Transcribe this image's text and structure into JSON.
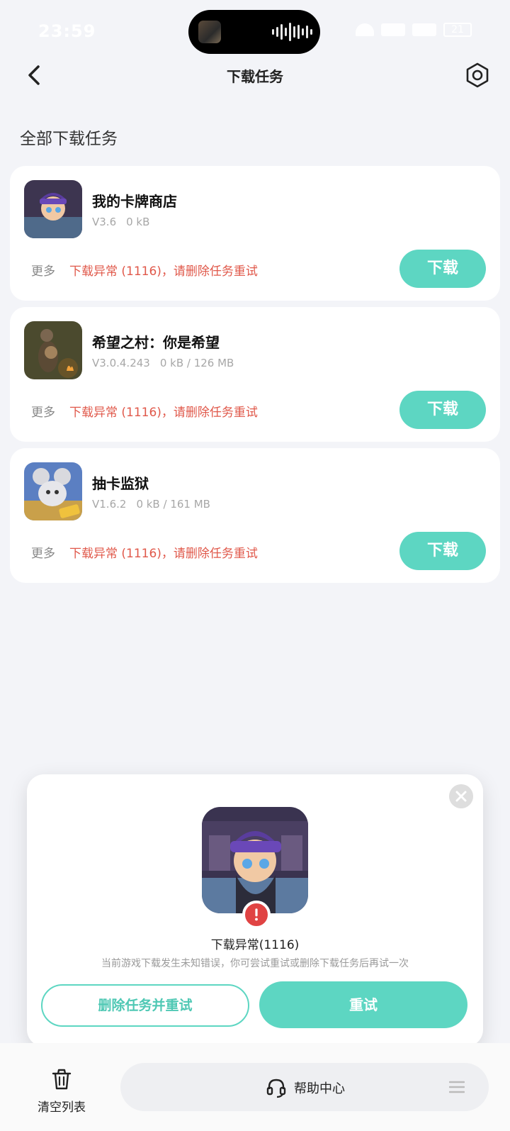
{
  "status_bar": {
    "time": "23:59",
    "battery": "21"
  },
  "nav": {
    "title": "下载任务"
  },
  "section_title": "全部下载任务",
  "tasks": [
    {
      "name": "我的卡牌商店",
      "version": "V3.6",
      "size": "0 kB",
      "more_label": "更多",
      "error_text": "下载异常 (1116)，请删除任务重试",
      "button_label": "下载"
    },
    {
      "name": "希望之村：你是希望",
      "version": "V3.0.4.243",
      "size": "0 kB / 126 MB",
      "more_label": "更多",
      "error_text": "下载异常 (1116)，请删除任务重试",
      "button_label": "下载"
    },
    {
      "name": "抽卡监狱",
      "version": "V1.6.2",
      "size": "0 kB / 161 MB",
      "more_label": "更多",
      "error_text": "下载异常 (1116)，请删除任务重试",
      "button_label": "下载"
    }
  ],
  "dialog": {
    "title": "下载异常(1116)",
    "description": "当前游戏下载发生未知错误，你可尝试重试或删除下载任务后再试一次",
    "delete_retry_label": "删除任务并重试",
    "retry_label": "重试"
  },
  "bottom_bar": {
    "clear_label": "清空列表",
    "help_label": "帮助中心"
  },
  "colors": {
    "accent": "#5dd6c2",
    "error": "#e0584a",
    "background": "#f3f4f8"
  }
}
